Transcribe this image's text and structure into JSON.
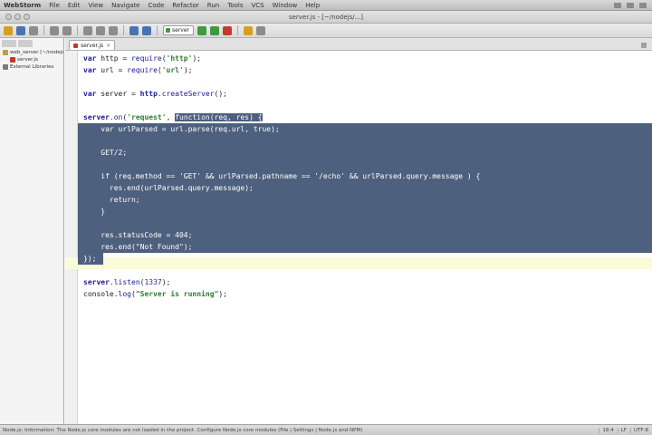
{
  "menubar": {
    "items": [
      "WebStorm",
      "File",
      "Edit",
      "View",
      "Navigate",
      "Code",
      "Refactor",
      "Run",
      "Tools",
      "VCS",
      "Window",
      "Help"
    ]
  },
  "window": {
    "title": "server.js - [~/nodejs/...]"
  },
  "toolbar": {
    "run_config": "server"
  },
  "project": {
    "items": [
      {
        "label": "web_server [~/nodejs]",
        "icon": "folder-icon",
        "level": 0
      },
      {
        "label": "server.js",
        "icon": "js-file-icon",
        "level": 1
      },
      {
        "label": "External Libraries",
        "icon": "library-icon",
        "level": 0
      }
    ]
  },
  "editor": {
    "tab_label": "server.js",
    "line_numbers": [],
    "lines": [
      {
        "segs": [
          [
            "kw",
            "var "
          ],
          [
            "",
            "http = "
          ],
          [
            "fn",
            "require"
          ],
          [
            "",
            "("
          ],
          [
            "str",
            "'http'"
          ],
          [
            "",
            ");"
          ]
        ]
      },
      {
        "segs": [
          [
            "kw",
            "var "
          ],
          [
            "",
            "url = "
          ],
          [
            "fn",
            "require"
          ],
          [
            "",
            "("
          ],
          [
            "str",
            "'url'"
          ],
          [
            "",
            ");"
          ]
        ]
      },
      {
        "segs": []
      },
      {
        "segs": [
          [
            "kw",
            "var "
          ],
          [
            "",
            "server = "
          ],
          [
            "kw",
            "http"
          ],
          [
            "",
            "."
          ],
          [
            "fn",
            "createServer"
          ],
          [
            "",
            "();"
          ]
        ]
      },
      {
        "segs": []
      },
      {
        "segs": [
          [
            "kw",
            "server"
          ],
          [
            "",
            "."
          ],
          [
            "fn",
            "on"
          ],
          [
            "",
            "("
          ],
          [
            "str",
            "'request'"
          ],
          [
            "",
            ", "
          ],
          [
            "sel",
            "function(req, res) {"
          ]
        ]
      },
      {
        "selected": true,
        "segs": [
          [
            "",
            "    var urlParsed = url.parse(req.url, true);"
          ]
        ]
      },
      {
        "selected": true,
        "segs": []
      },
      {
        "selected": true,
        "segs": [
          [
            "",
            "    GET/2;"
          ]
        ]
      },
      {
        "selected": true,
        "segs": []
      },
      {
        "selected": true,
        "segs": [
          [
            "",
            "    if (req.method == 'GET' && urlParsed.pathname == '/echo' && urlParsed.query.message ) {"
          ]
        ]
      },
      {
        "selected": true,
        "segs": [
          [
            "",
            "      res.end(urlParsed.query.message);"
          ]
        ]
      },
      {
        "selected": true,
        "segs": [
          [
            "",
            "      return;"
          ]
        ]
      },
      {
        "selected": true,
        "segs": [
          [
            "",
            "    }"
          ]
        ]
      },
      {
        "selected": true,
        "segs": []
      },
      {
        "selected": true,
        "segs": [
          [
            "",
            "    res.statusCode = 404;"
          ]
        ]
      },
      {
        "selected": true,
        "segs": [
          [
            "",
            "    res.end(\"Not Found\");"
          ]
        ]
      },
      {
        "selected": true,
        "short": true,
        "segs": [
          [
            "",
            "});"
          ]
        ]
      },
      {
        "segs": []
      },
      {
        "segs": [
          [
            "kw",
            "server"
          ],
          [
            "",
            "."
          ],
          [
            "fn",
            "listen"
          ],
          [
            "",
            "("
          ],
          [
            "num",
            "1337"
          ],
          [
            "",
            ");"
          ]
        ]
      },
      {
        "segs": [
          [
            "",
            "console."
          ],
          [
            "fn",
            "log"
          ],
          [
            "",
            "("
          ],
          [
            "str",
            "\"Server is running\""
          ],
          [
            "",
            ");"
          ]
        ]
      }
    ]
  },
  "status": {
    "message": "Node.js: Information: The Node.js core modules are not loaded in the project. Configure Node.js core modules (File | Settings | Node.js and NPM)",
    "position": "18:4",
    "encoding": "UTF-8",
    "line_sep": "LF"
  },
  "colors": {
    "selection": "#4d607d",
    "keyword": "#1a1a9a",
    "string": "#2e7d2e",
    "caret_line": "#fafbd9"
  }
}
